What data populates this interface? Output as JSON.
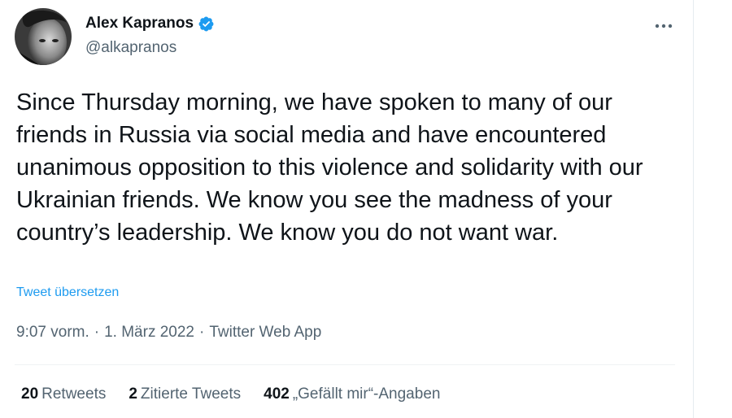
{
  "author": {
    "display_name": "Alex Kapranos",
    "handle": "@alkapranos",
    "verified_icon": "verified-badge-icon",
    "avatar": "avatar"
  },
  "menu_icon": "more-options-icon",
  "tweet": {
    "text": "Since Thursday morning, we have spoken to many of our friends in Russia via social media and have encountered unanimous opposition to this violence and solidarity with our Ukrainian friends. We know you see the madness of your country’s leadership. We know you do not want war.",
    "translate_label": "Tweet übersetzen"
  },
  "meta": {
    "time": "9:07 vorm.",
    "separator": "·",
    "date": "1. März 2022",
    "source": "Twitter Web App"
  },
  "stats": {
    "retweets_count": "20",
    "retweets_label": "Retweets",
    "quotes_count": "2",
    "quotes_label": "Zitierte Tweets",
    "likes_count": "402",
    "likes_label": "„Gefällt mir“-Angaben"
  },
  "colors": {
    "accent": "#1d9bf0",
    "secondary_text": "#536471",
    "primary_text": "#0f1419"
  }
}
